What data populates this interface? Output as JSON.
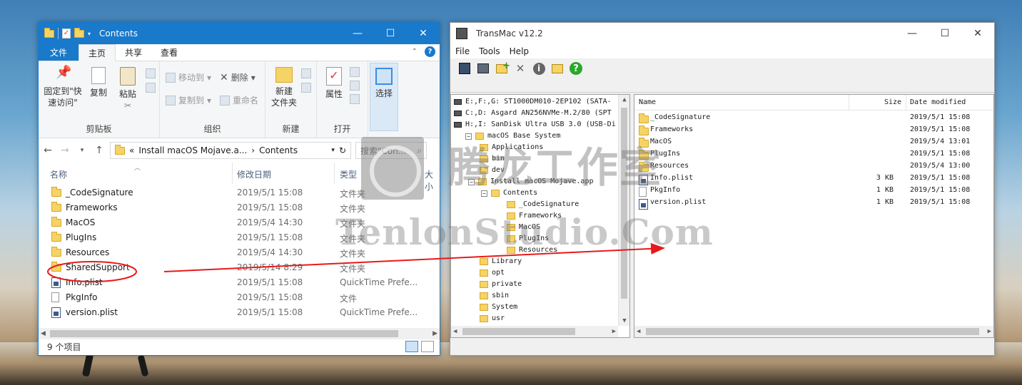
{
  "explorer": {
    "title": "Contents",
    "tabs": [
      {
        "label": "文件"
      },
      {
        "label": "主页"
      },
      {
        "label": "共享"
      },
      {
        "label": "查看"
      }
    ],
    "ribbon": {
      "pin_label_1": "固定到\"快",
      "pin_label_2": "速访问\"",
      "copy_label": "复制",
      "paste_label": "粘贴",
      "clipboard_group": "剪贴板",
      "move_to": "移动到",
      "copy_to": "复制到",
      "delete": "删除",
      "rename": "重命名",
      "organize_group": "组织",
      "new_folder_1": "新建",
      "new_folder_2": "文件夹",
      "new_group": "新建",
      "properties": "属性",
      "open_group": "打开",
      "select": "选择"
    },
    "address": {
      "prefix": "«",
      "crumb1": "Install macOS Mojave.a...",
      "sep": "›",
      "crumb2": "Contents",
      "search_placeholder": "搜索\"Con..."
    },
    "columns": {
      "name": "名称",
      "date": "修改日期",
      "type": "类型",
      "size": "大小"
    },
    "files": [
      {
        "name": "_CodeSignature",
        "date": "2019/5/1 15:08",
        "type": "文件夹",
        "icon": "folder-icon"
      },
      {
        "name": "Frameworks",
        "date": "2019/5/1 15:08",
        "type": "文件夹",
        "icon": "folder-icon"
      },
      {
        "name": "MacOS",
        "date": "2019/5/4 14:30",
        "type": "文件夹",
        "icon": "folder-icon"
      },
      {
        "name": "PlugIns",
        "date": "2019/5/1 15:08",
        "type": "文件夹",
        "icon": "folder-icon"
      },
      {
        "name": "Resources",
        "date": "2019/5/4 14:30",
        "type": "文件夹",
        "icon": "folder-icon"
      },
      {
        "name": "SharedSupport",
        "date": "2019/5/14 8:29",
        "type": "文件夹",
        "icon": "folder-icon"
      },
      {
        "name": "Info.plist",
        "date": "2019/5/1 15:08",
        "type": "QuickTime Prefe...",
        "icon": "plist-icon"
      },
      {
        "name": "PkgInfo",
        "date": "2019/5/1 15:08",
        "type": "文件",
        "icon": "file-icon"
      },
      {
        "name": "version.plist",
        "date": "2019/5/1 15:08",
        "type": "QuickTime Prefe...",
        "icon": "plist-icon"
      }
    ],
    "status": "9 个项目"
  },
  "transmac": {
    "title": "TransMac v12.2",
    "menu": [
      {
        "label": "File"
      },
      {
        "label": "Tools"
      },
      {
        "label": "Help"
      }
    ],
    "tree": [
      {
        "label": "E:,F:,G:  ST1000DM010-2EP102 (SATA-",
        "kind": "drive"
      },
      {
        "label": "C:,D:  Asgard AN256NVMe-M.2/80 (SPT",
        "kind": "drive"
      },
      {
        "label": "H:,I: SanDisk Ultra USB 3.0 (USB-Di",
        "kind": "drive"
      },
      {
        "label": "macOS Base System",
        "kind": "folder"
      },
      {
        "label": "Applications",
        "kind": "folder"
      },
      {
        "label": "bin",
        "kind": "folder"
      },
      {
        "label": "dev",
        "kind": "folder"
      },
      {
        "label": "Install macOS Mojave.app",
        "kind": "folder"
      },
      {
        "label": "Contents",
        "kind": "folder"
      },
      {
        "label": "_CodeSignature",
        "kind": "folder"
      },
      {
        "label": "Frameworks",
        "kind": "folder"
      },
      {
        "label": "MacOS",
        "kind": "folder"
      },
      {
        "label": "PlugIns",
        "kind": "folder"
      },
      {
        "label": "Resources",
        "kind": "folder"
      },
      {
        "label": "Library",
        "kind": "folder"
      },
      {
        "label": "opt",
        "kind": "folder"
      },
      {
        "label": "private",
        "kind": "folder"
      },
      {
        "label": "sbin",
        "kind": "folder"
      },
      {
        "label": "System",
        "kind": "folder"
      },
      {
        "label": "usr",
        "kind": "folder"
      }
    ],
    "list_columns": {
      "name": "Name",
      "size": "Size",
      "date": "Date modified"
    },
    "list": [
      {
        "name": "_CodeSignature",
        "size": "",
        "date": "2019/5/1 15:08",
        "icon": "folder-icon"
      },
      {
        "name": "Frameworks",
        "size": "",
        "date": "2019/5/1 15:08",
        "icon": "folder-icon"
      },
      {
        "name": "MacOS",
        "size": "",
        "date": "2019/5/4 13:01",
        "icon": "folder-icon"
      },
      {
        "name": "PlugIns",
        "size": "",
        "date": "2019/5/1 15:08",
        "icon": "folder-icon"
      },
      {
        "name": "Resources",
        "size": "",
        "date": "2019/5/4 13:00",
        "icon": "folder-icon"
      },
      {
        "name": "Info.plist",
        "size": "3 KB",
        "date": "2019/5/1 15:08",
        "icon": "plist-icon"
      },
      {
        "name": "PkgInfo",
        "size": "1 KB",
        "date": "2019/5/1 15:08",
        "icon": "file-icon"
      },
      {
        "name": "version.plist",
        "size": "1 KB",
        "date": "2019/5/1 15:08",
        "icon": "plist-icon"
      }
    ]
  },
  "watermark": {
    "cn": "腾龙工作室",
    "en": "TenlonStudio.Com"
  },
  "colors": {
    "accent": "#1979ca",
    "annotation": "#e8191b"
  }
}
